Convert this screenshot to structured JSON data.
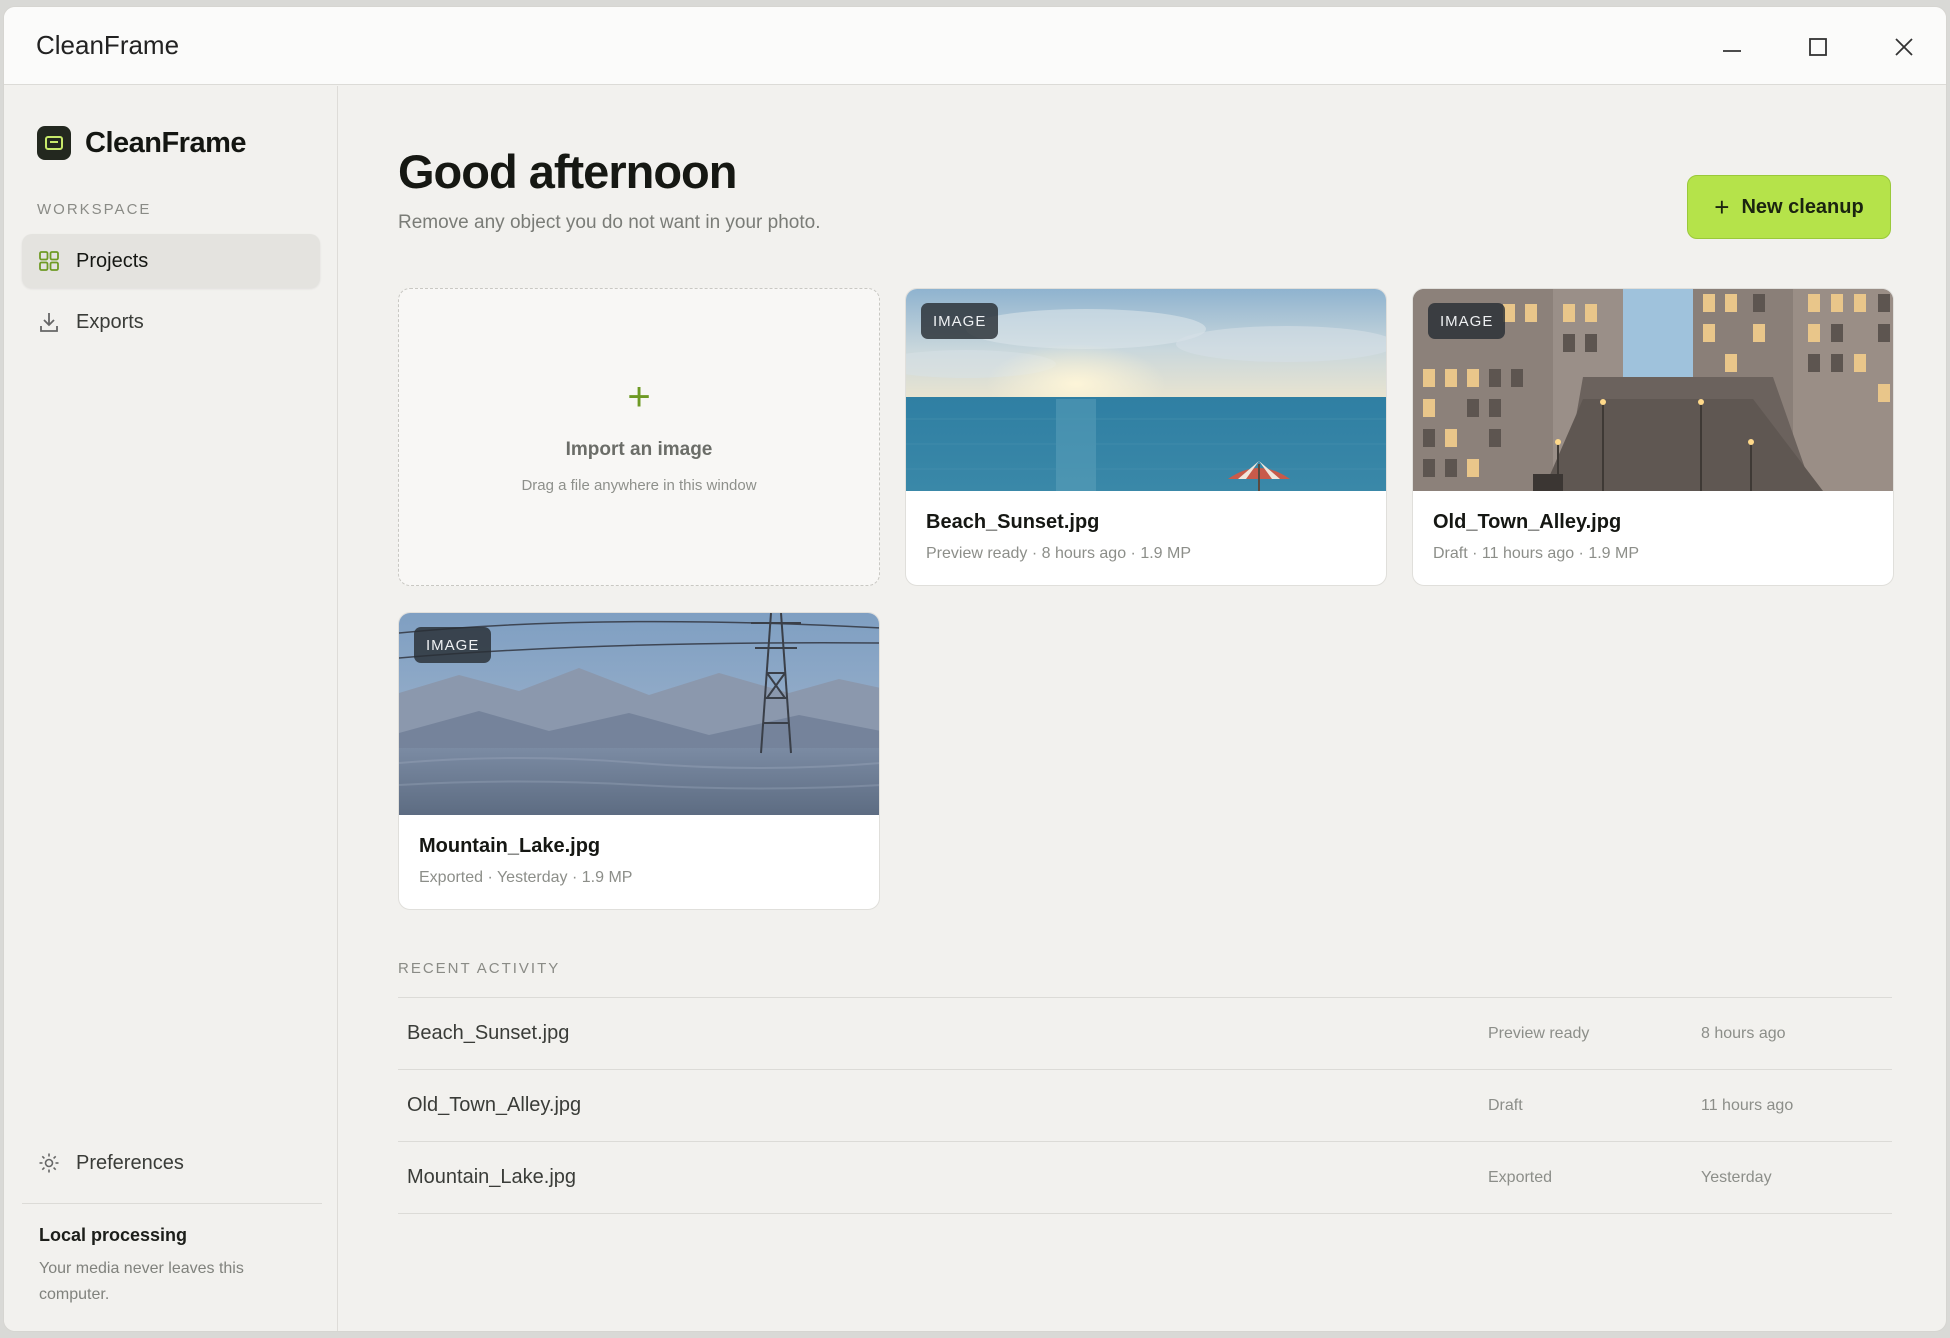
{
  "window": {
    "title": "CleanFrame",
    "controls": {
      "minimize": "minimize-icon",
      "maximize": "maximize-icon",
      "close": "close-icon"
    }
  },
  "sidebar": {
    "brand": "CleanFrame",
    "section_label": "WORKSPACE",
    "items": [
      {
        "label": "Projects",
        "icon": "grid-icon",
        "active": true
      },
      {
        "label": "Exports",
        "icon": "download-icon",
        "active": false
      }
    ],
    "preferences": {
      "label": "Preferences",
      "icon": "gear-icon"
    },
    "local": {
      "title": "Local processing",
      "description": "Your media never leaves this computer."
    }
  },
  "main": {
    "greeting": "Good afternoon",
    "subtitle": "Remove any object you do not want in your photo.",
    "new_button": {
      "plus": "+",
      "label": "New cleanup"
    },
    "import": {
      "plus": "+",
      "title": "Import an image",
      "description": "Drag a file anywhere in this window"
    },
    "cards": [
      {
        "badge": "IMAGE",
        "name": "Beach_Sunset.jpg",
        "meta": "Preview ready · 8 hours ago · 1.9 MP"
      },
      {
        "badge": "IMAGE",
        "name": "Old_Town_Alley.jpg",
        "meta": "Draft · 11 hours ago · 1.9 MP"
      },
      {
        "badge": "IMAGE",
        "name": "Mountain_Lake.jpg",
        "meta": "Exported · Yesterday · 1.9 MP"
      }
    ],
    "recent": {
      "label": "RECENT ACTIVITY",
      "rows": [
        {
          "name": "Beach_Sunset.jpg",
          "status": "Preview ready",
          "time": "8 hours ago"
        },
        {
          "name": "Old_Town_Alley.jpg",
          "status": "Draft",
          "time": "11 hours ago"
        },
        {
          "name": "Mountain_Lake.jpg",
          "status": "Exported",
          "time": "Yesterday"
        }
      ]
    }
  },
  "colors": {
    "accent": "#b5e34a",
    "accent_icon": "#6e9a24",
    "background": "#f2f1ee",
    "text": "#161813"
  }
}
